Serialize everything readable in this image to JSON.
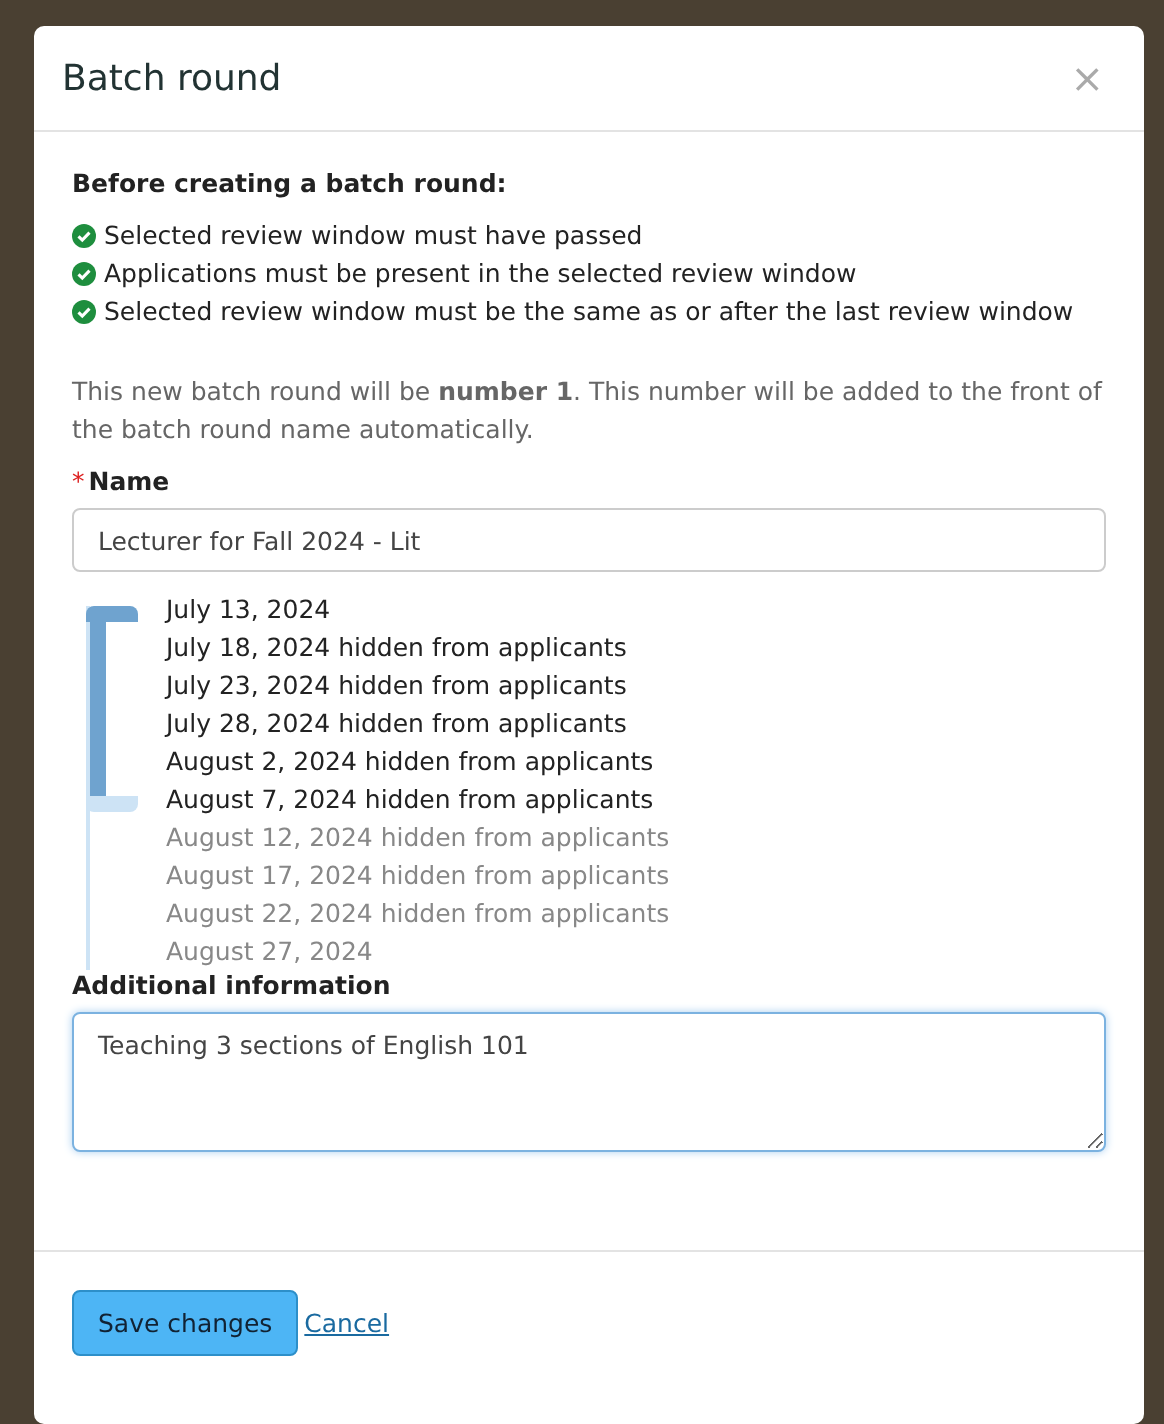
{
  "dialog": {
    "title": "Batch round",
    "close": "×"
  },
  "requirements": {
    "heading": "Before creating a batch round:",
    "items": [
      {
        "text": "Selected review window must have passed",
        "met": true
      },
      {
        "text": "Applications must be present in the selected review window",
        "met": true
      },
      {
        "text": "Selected review window must be the same as or after the last review window",
        "met": true
      }
    ]
  },
  "note": "This new batch round will be **number 1**. This number will be added to the front of the batch round name automatically.",
  "name_field": {
    "required_mark": "*",
    "label": "Name",
    "value": "Lecturer for Fall 2024 - Lit"
  },
  "review_windows": [
    {
      "label": "July 13, 2024",
      "in_range": true
    },
    {
      "label": "July 18, 2024 hidden from applicants",
      "in_range": true
    },
    {
      "label": "July 23, 2024 hidden from applicants",
      "in_range": true
    },
    {
      "label": "July 28, 2024 hidden from applicants",
      "in_range": true
    },
    {
      "label": "August 2, 2024 hidden from applicants",
      "in_range": true
    },
    {
      "label": "August 7, 2024 hidden from applicants",
      "in_range": true
    },
    {
      "label": "August 12, 2024 hidden from applicants",
      "in_range": false
    },
    {
      "label": "August 17, 2024 hidden from applicants",
      "in_range": false
    },
    {
      "label": "August 22, 2024 hidden from applicants",
      "in_range": false
    },
    {
      "label": "August 27, 2024",
      "in_range": false
    }
  ],
  "info_field": {
    "label": "Additional information",
    "value": "Teaching 3 sections of English 101"
  },
  "buttons": {
    "save": "Save changes",
    "cancel": "Cancel"
  }
}
